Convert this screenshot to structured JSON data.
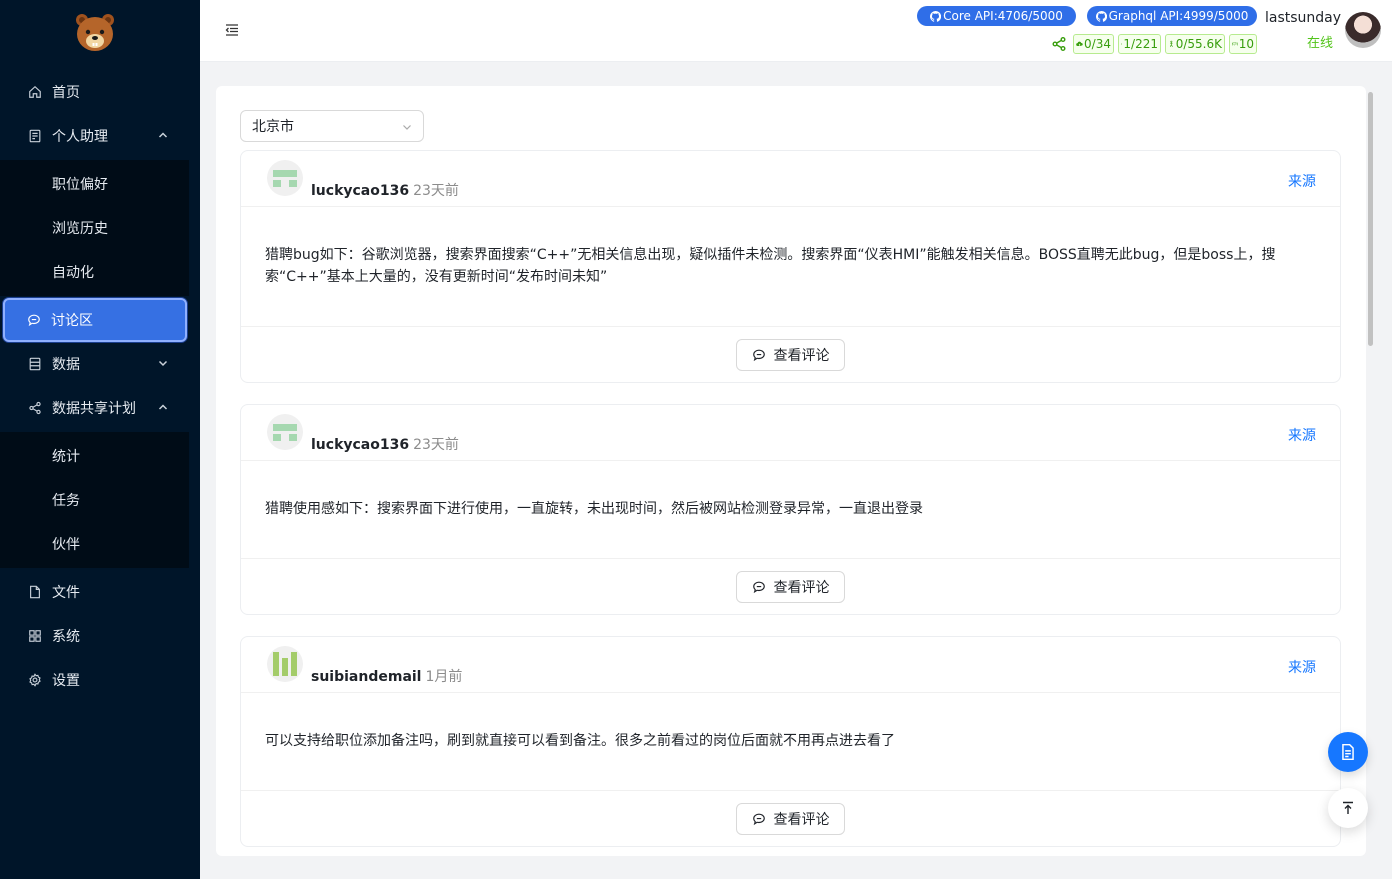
{
  "sidebar": {
    "menu": [
      {
        "label": "首页",
        "icon": "home-icon"
      },
      {
        "label": "个人助理",
        "icon": "assistant-icon",
        "expanded": true
      },
      {
        "label": "讨论区",
        "icon": "chat-icon",
        "active": true
      },
      {
        "label": "数据",
        "icon": "database-icon",
        "expanded": false
      },
      {
        "label": "数据共享计划",
        "icon": "share-icon",
        "expanded": true
      },
      {
        "label": "文件",
        "icon": "file-icon"
      },
      {
        "label": "系统",
        "icon": "apps-icon"
      },
      {
        "label": "设置",
        "icon": "settings-icon"
      }
    ],
    "assistant_sub": [
      "职位偏好",
      "浏览历史",
      "自动化"
    ],
    "share_sub": [
      "统计",
      "任务",
      "伙伴"
    ]
  },
  "header": {
    "core_api": "Core API:4706/5000",
    "graphql_api": "Graphql API:4999/5000",
    "username": "lastsunday",
    "status": "在线",
    "stats": [
      "0/34",
      "1/221",
      "0/55.6K",
      "10"
    ]
  },
  "filter": {
    "city": "北京市"
  },
  "posts": [
    {
      "user": "luckycao136",
      "time": "23天前",
      "source": "来源",
      "content": "猎聘bug如下：谷歌浏览器，搜索界面搜索“C++”无相关信息出现，疑似插件未检测。搜索界面“仪表HMI”能触发相关信息。BOSS直聘无此bug，但是boss上，搜索“C++”基本上大量的，没有更新时间“发布时间未知”",
      "comment_label": "查看评论"
    },
    {
      "user": "luckycao136",
      "time": "23天前",
      "source": "来源",
      "content": "猎聘使用感如下：搜索界面下进行使用，一直旋转，未出现时间，然后被网站检测登录异常，一直退出登录",
      "comment_label": "查看评论"
    },
    {
      "user": "suibiandemail",
      "time": "1月前",
      "source": "来源",
      "content": "可以支持给职位添加备注吗，刷到就直接可以看到备注。很多之前看过的岗位后面就不用再点进去看了",
      "comment_label": "查看评论"
    }
  ],
  "colors": {
    "sidebar_bg": "#001529",
    "submenu_bg": "#000c17",
    "active": "#3670e3",
    "link": "#1677ff",
    "success": "#52c41a"
  }
}
